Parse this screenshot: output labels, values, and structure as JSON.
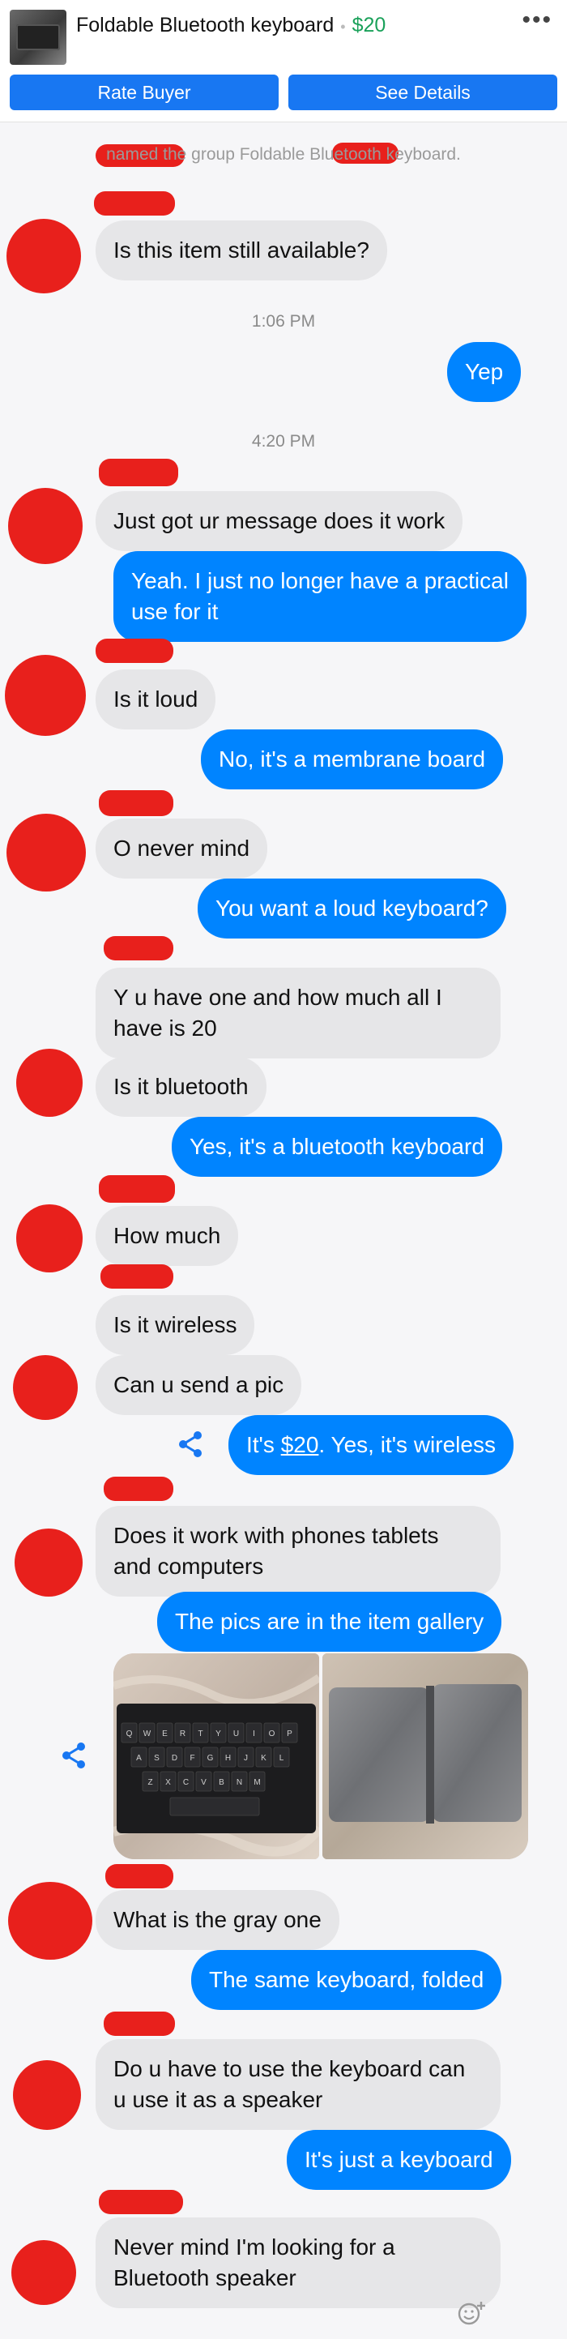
{
  "header": {
    "item_title": "Foldable Bluetooth keyboard",
    "price": "$20",
    "more_icon": "more-dots-icon",
    "rate_buyer_label": "Rate Buyer",
    "see_details_label": "See Details"
  },
  "system_notice": "named the group Foldable Bluetooth keyboard.",
  "timestamps": [
    "1:06 PM",
    "4:20 PM"
  ],
  "messages": {
    "m1": "Is this item still available?",
    "m2": "Yep",
    "m3": "Just got ur message does it work",
    "m4": "Yeah. I just no longer have a practical use for it",
    "m5": "Is it loud",
    "m6": "No, it's a membrane board",
    "m7": "O never mind",
    "m8": "You want a loud keyboard?",
    "m9": "Y u have one and how much all I have is 20",
    "m10": "Is it bluetooth",
    "m11": "Yes, it's a bluetooth keyboard",
    "m12": "How much",
    "m13": "Is it wireless",
    "m14": "Can u send a pic",
    "m15_prefix": "It's ",
    "m15_link": "$20",
    "m15_suffix": ". Yes, it's wireless",
    "m16": "Does it work with phones tablets and computers",
    "m17": "The pics are in the item gallery",
    "m18": "What is the gray one",
    "m19": "The same keyboard, folded",
    "m20": "Do u have to use the keyboard can u use it as a speaker",
    "m21": "It's just a keyboard",
    "m22": "Never mind I'm looking for a Bluetooth speaker"
  },
  "keyboard_keys": [
    "Q",
    "W",
    "E",
    "R",
    "T",
    "Y",
    "U",
    "I",
    "O",
    "P",
    "A",
    "S",
    "D",
    "F",
    "G",
    "H",
    "J",
    "K",
    "L",
    "Z",
    "X",
    "C",
    "V",
    "B",
    "N",
    "M"
  ],
  "colors": {
    "outgoing": "#0084ff",
    "incoming": "#e6e6e8",
    "accent": "#1877f2",
    "price": "#1aa15a",
    "redaction": "#e8201c"
  }
}
